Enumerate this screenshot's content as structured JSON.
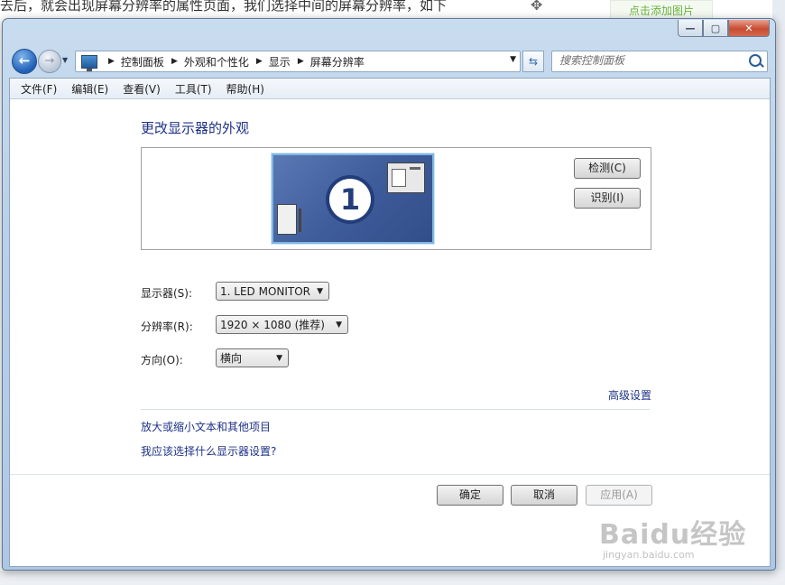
{
  "background": {
    "article_text": "去后，就会出现屏幕分辨率的属性页面，我们选择中间的屏幕分辨率，如下",
    "add_image_label": "点击添加图片"
  },
  "window": {
    "caption_buttons": [
      "—",
      "▢",
      "✕"
    ]
  },
  "addressbar": {
    "breadcrumbs": [
      "控制面板",
      "外观和个性化",
      "显示",
      "屏幕分辨率"
    ],
    "search_placeholder": "搜索控制面板"
  },
  "menu": {
    "items": [
      "文件(F)",
      "编辑(E)",
      "查看(V)",
      "工具(T)",
      "帮助(H)"
    ]
  },
  "main": {
    "heading": "更改显示器的外观",
    "monitor_number": "1",
    "detect_label": "检测(C)",
    "identify_label": "识别(I)",
    "display_label": "显示器(S):",
    "display_value": "1. LED MONITOR",
    "resolution_label": "分辨率(R):",
    "resolution_value": "1920 × 1080 (推荐)",
    "orientation_label": "方向(O):",
    "orientation_value": "横向",
    "advanced_link": "高级设置",
    "text_size_link": "放大或缩小文本和其他项目",
    "which_settings_link": "我应该选择什么显示器设置?"
  },
  "buttons": {
    "ok": "确定",
    "cancel": "取消",
    "apply": "应用(A)"
  },
  "watermark": {
    "logo": "Baidu经验",
    "url": "jingyan.baidu.com"
  }
}
